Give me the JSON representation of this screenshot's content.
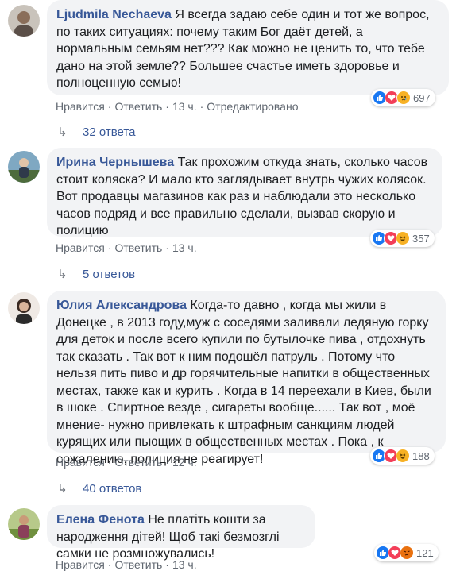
{
  "comments": [
    {
      "author": "Ljudmila Nechaeva",
      "text": "Я всегда задаю себе один и тот же вопрос, по таких ситуациях: почему таким Бог даёт детей, а нормальным семьям нет??? Как можно не ценить то, что тебе дано на этой земле?? Большее счастье иметь здоровье и полноценную семью!",
      "like": "Нравится",
      "reply": "Ответить",
      "time": "13 ч.",
      "edited": "Отредактировано",
      "reactions": [
        "like",
        "love",
        "sad"
      ],
      "count": "697",
      "replies": "32 ответа"
    },
    {
      "author": "Ирина Чернышева",
      "text": "Так прохожим откуда знать, сколько часов стоит коляска? И мало кто заглядывает внутрь чужих колясок. Вот продавцы магазинов как раз и наблюдали это несколько часов подряд и все правильно сделали, вызвав скорую и полицию",
      "like": "Нравится",
      "reply": "Ответить",
      "time": "13 ч.",
      "reactions": [
        "like",
        "love",
        "haha"
      ],
      "count": "357",
      "replies": "5 ответов"
    },
    {
      "author": "Юлия Александрова",
      "text": "Когда-то давно , когда мы жили в Донецке , в 2013 году,муж с соседями заливали ледяную горку для деток и после всего купили по бутылочке пива , отдохнуть так сказать . Так вот к ним подошёл патруль . Потому что нельзя пить пиво и др горячительные напитки в общественных местах, также как и курить . Когда в 14 переехали в Киев, были в шоке . Спиртное везде , сигареты вообще...... Так вот , моё мнение- нужно привлекать к штрафным санкциям людей курящих или пьющих в общественных местах . Пока , к сожалению, полиция не реагирует!",
      "like": "Нравится",
      "reply": "Ответить",
      "time": "12 ч.",
      "reactions": [
        "like",
        "love",
        "haha"
      ],
      "count": "188",
      "replies": "40 ответов"
    },
    {
      "author": "Елена Фенота",
      "text": "Не платіть кошти за народження дітей! Щоб такі безмозглі самки не розмножувались!",
      "like": "Нравится",
      "reply": "Ответить",
      "time": "13 ч.",
      "reactions": [
        "like",
        "love",
        "angry"
      ],
      "count": "121"
    }
  ],
  "colors": {
    "like": "#1877f2",
    "love": "#f33e58",
    "sad": "#f7b125",
    "haha": "#f7b125",
    "angry": "#e9710f"
  }
}
